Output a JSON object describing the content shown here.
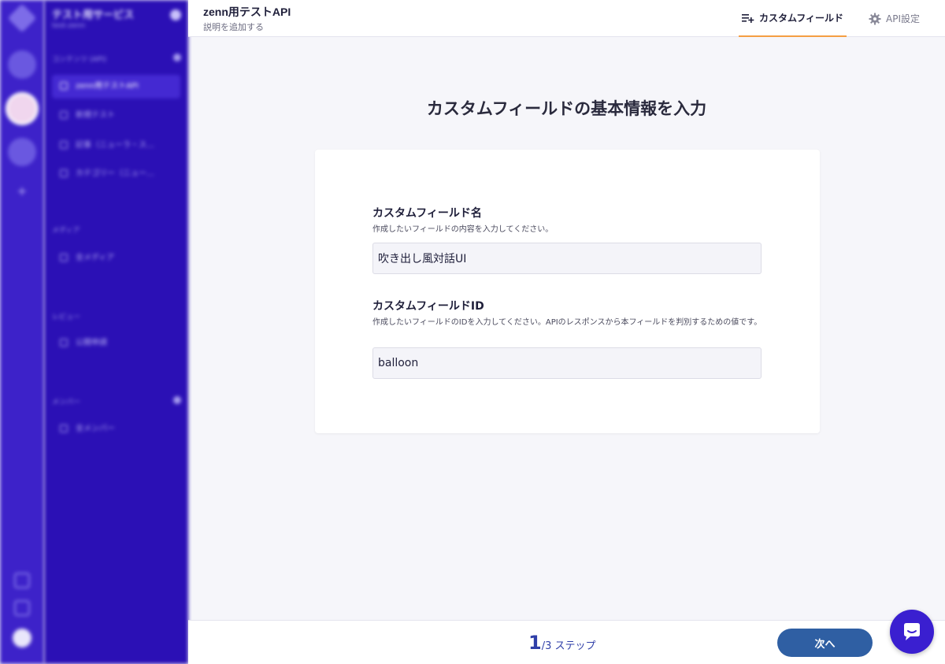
{
  "sidebar": {
    "service_name": "テスト用サービス",
    "service_sub": "test-zenn",
    "sections": [
      {
        "label": "コンテンツ (API)"
      },
      {
        "label": "メディア"
      },
      {
        "label": "レビュー"
      },
      {
        "label": "メンバー"
      }
    ],
    "api_items": [
      {
        "label": "zenn用テストAPI"
      },
      {
        "label": "新規テスト"
      },
      {
        "label": "記事（ニューラ・ス…"
      },
      {
        "label": "カテゴリー（ニュー…"
      }
    ],
    "media_item": "全メディア",
    "review_item": "公開申請",
    "member_item": "全メンバー"
  },
  "header": {
    "api_name": "zenn用テストAPI",
    "api_description": "説明を追加する",
    "tabs": [
      {
        "label": "カスタムフィールド",
        "icon": "playlist-add-icon",
        "active": true
      },
      {
        "label": "API設定",
        "icon": "gear-icon",
        "active": false
      }
    ]
  },
  "main": {
    "heading": "カスタムフィールドの基本情報を入力",
    "fields": [
      {
        "label": "カスタムフィールド名",
        "help": "作成したいフィールドの内容を入力してください。",
        "value": "吹き出し風対話UI"
      },
      {
        "label": "カスタムフィールドID",
        "help": "作成したいフィールドのIDを入力してください。APIのレスポンスから本フィールドを判別するための値です。",
        "value": "balloon"
      }
    ]
  },
  "footer": {
    "step_current": "1",
    "step_total": "/3 ステップ",
    "next_label": "次へ"
  },
  "colors": {
    "accent": "#f59e42",
    "primary": "#2f5fa3",
    "sidebar": "#2b10b5"
  }
}
